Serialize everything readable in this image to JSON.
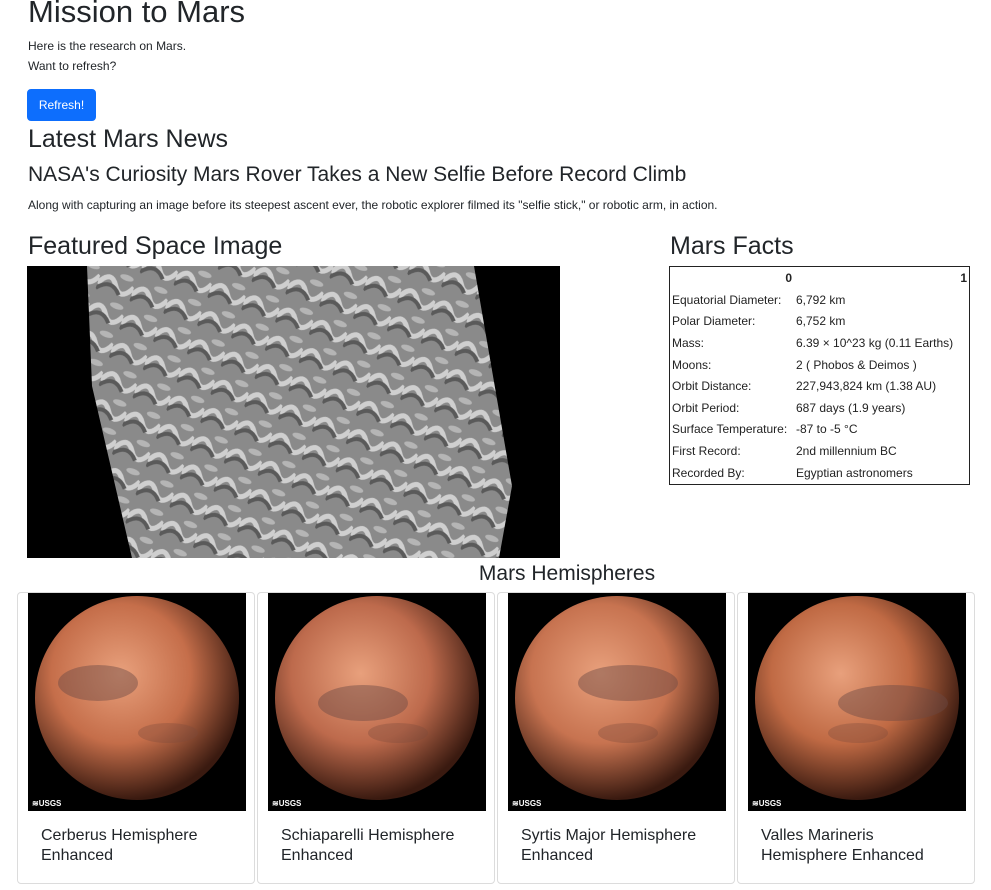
{
  "header": {
    "title": "Mission to Mars",
    "line1": "Here is the research on Mars.",
    "line2": "Want to refresh?",
    "button_label": "Refresh!"
  },
  "news": {
    "section_title": "Latest Mars News",
    "headline": "NASA's Curiosity Mars Rover Takes a New Selfie Before Record Climb",
    "teaser": "Along with capturing an image before its steepest ascent ever, the robotic explorer filmed its \"selfie stick,\" or robotic arm, in action."
  },
  "featured": {
    "section_title": "Featured Space Image"
  },
  "facts": {
    "section_title": "Mars Facts",
    "col0": "0",
    "col1": "1",
    "rows": [
      {
        "label": "Equatorial Diameter:",
        "value": "6,792 km"
      },
      {
        "label": "Polar Diameter:",
        "value": "6,752 km"
      },
      {
        "label": "Mass:",
        "value": "6.39 × 10^23 kg (0.11 Earths)"
      },
      {
        "label": "Moons:",
        "value": "2 ( Phobos & Deimos )"
      },
      {
        "label": "Orbit Distance:",
        "value": "227,943,824 km (1.38 AU)"
      },
      {
        "label": "Orbit Period:",
        "value": "687 days (1.9 years)"
      },
      {
        "label": "Surface Temperature:",
        "value": "-87 to -5 °C"
      },
      {
        "label": "First Record:",
        "value": "2nd millennium BC"
      },
      {
        "label": "Recorded By:",
        "value": "Egyptian astronomers"
      }
    ]
  },
  "hemispheres": {
    "section_title": "Mars Hemispheres",
    "items": [
      {
        "title": "Cerberus Hemisphere Enhanced",
        "logo": "≋USGS",
        "color": "#c56e4a"
      },
      {
        "title": "Schiaparelli Hemisphere Enhanced",
        "logo": "≋USGS",
        "color": "#bd6a4c"
      },
      {
        "title": "Syrtis Major Hemisphere Enhanced",
        "logo": "≋USGS",
        "color": "#c77350"
      },
      {
        "title": "Valles Marineris Hemisphere Enhanced",
        "logo": "≋USGS",
        "color": "#c06a44"
      }
    ]
  }
}
